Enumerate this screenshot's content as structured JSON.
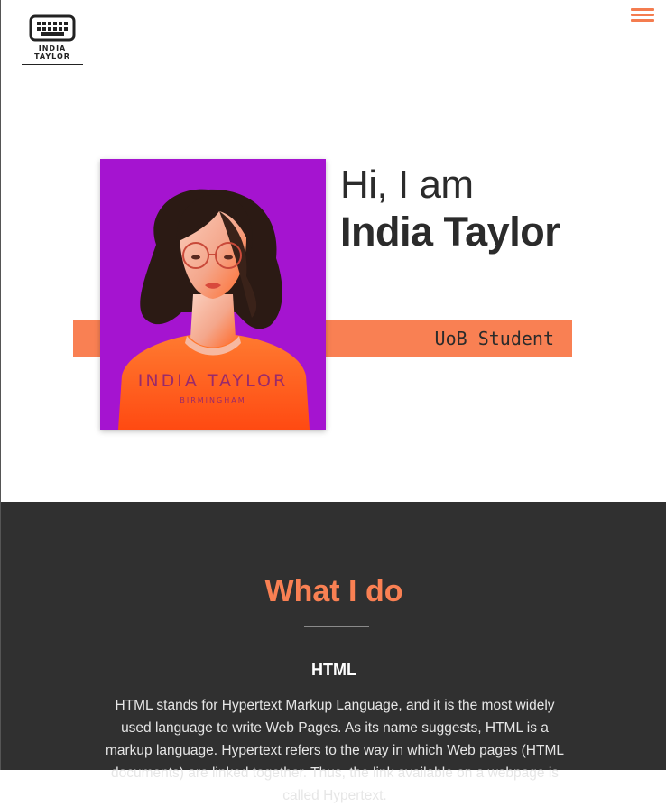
{
  "header": {
    "logo_line1": "INDIA",
    "logo_line2": "TAYLOR",
    "logo_icon": "keyboard-icon",
    "menu_icon": "hamburger-menu-icon"
  },
  "hero": {
    "greeting": "Hi, I am",
    "name": "India Taylor",
    "role": "UoB Student",
    "portrait": {
      "name_text": "INDIA TAYLOR",
      "city_text": "BIRMINGHAM"
    }
  },
  "section": {
    "title": "What I do",
    "subtitle": "HTML",
    "body": "HTML stands for Hypertext Markup Language, and it is the most widely used language to write Web Pages. As its name suggests, HTML is a markup language. Hypertext refers to the way in which Web pages (HTML documents) are linked together. Thus, the link available on a webpage is called Hypertext."
  },
  "colors": {
    "accent": "#f98053",
    "dark_bg": "#303030",
    "portrait_bg": "#a514d0"
  }
}
